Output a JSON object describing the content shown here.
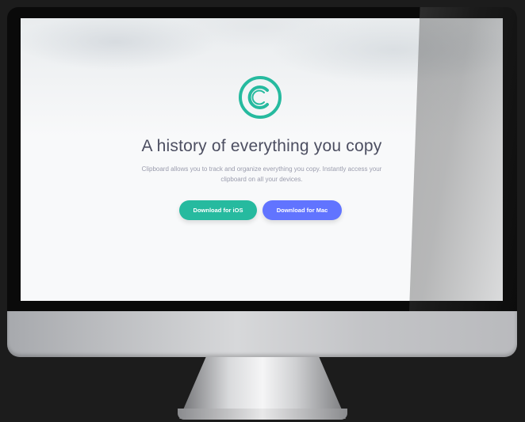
{
  "hero": {
    "title": "A history of everything you copy",
    "subtitle": "Clipboard allows you to track and organize everything you copy. Instantly access your clipboard on all your devices.",
    "logo_icon": "copyright-icon"
  },
  "buttons": {
    "ios_label": "Download for iOS",
    "mac_label": "Download for Mac"
  },
  "colors": {
    "accent_teal": "#26ba9f",
    "accent_blue": "#6174ff",
    "title_text": "#4c4e61",
    "body_text": "#9a9cad"
  }
}
